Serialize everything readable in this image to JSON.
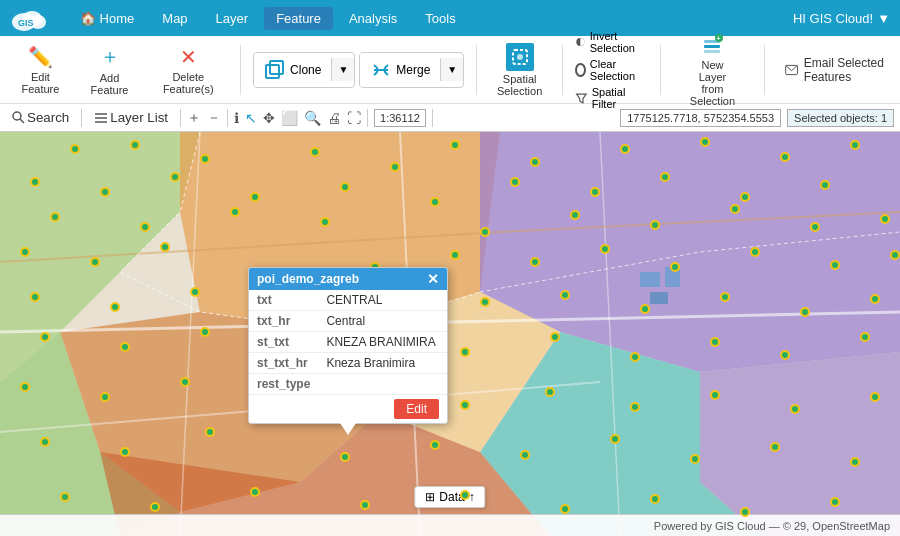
{
  "nav": {
    "logo_text": "GIS",
    "links": [
      {
        "label": "🏠 Home",
        "id": "home",
        "active": false
      },
      {
        "label": "Map",
        "id": "map",
        "active": false
      },
      {
        "label": "Layer",
        "id": "layer",
        "active": false
      },
      {
        "label": "Feature",
        "id": "feature",
        "active": true
      },
      {
        "label": "Analysis",
        "id": "analysis",
        "active": false
      },
      {
        "label": "Tools",
        "id": "tools",
        "active": false
      }
    ],
    "user_label": "HI GIS Cloud!",
    "user_arrow": "▼"
  },
  "toolbar": {
    "edit_feature": "Edit Feature",
    "add_feature": "Add Feature",
    "delete_feature": "Delete Feature(s)",
    "clone": "Clone",
    "merge": "Merge",
    "spatial_selection": "Spatial Selection",
    "invert_selection": "Invert Selection",
    "clear_selection": "Clear Selection",
    "spatial_filter": "Spatial Filter",
    "new_layer": "New Layer from Selection",
    "email_selected": "Email Selected Features"
  },
  "map_toolbar": {
    "search_label": "Search",
    "layer_list": "Layer List",
    "zoom_level": "1:36112",
    "coords": "1775125.7718, 5752354.5553",
    "selected": "Selected objects: 1"
  },
  "popup": {
    "title": "poi_demo_zagreb",
    "fields": [
      {
        "key": "txt",
        "value": "CENTRAL"
      },
      {
        "key": "txt_hr",
        "value": "Central"
      },
      {
        "key": "st_txt",
        "value": "KNEZA BRANIMIRA"
      },
      {
        "key": "st_txt_hr",
        "value": "Kneza Branimira"
      },
      {
        "key": "rest_type",
        "value": ""
      }
    ],
    "edit_label": "Edit"
  },
  "status_bar": {
    "powered_by": "Powered by GIS Cloud — © 29, OpenStreetMap"
  },
  "data_button": {
    "label": "Data",
    "icon": "⊞"
  }
}
